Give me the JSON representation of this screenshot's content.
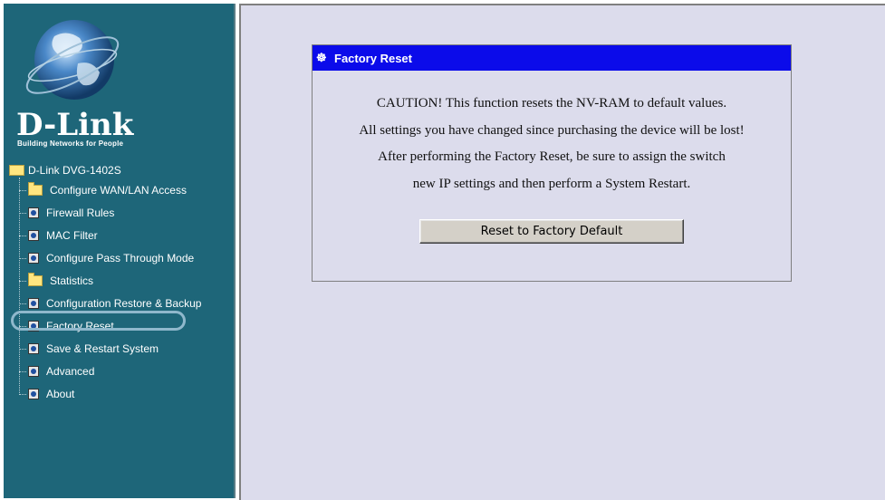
{
  "logo": {
    "brand": "D-Link",
    "tagline": "Building Networks for People"
  },
  "tree": {
    "root_label": "D-Link DVG-1402S",
    "items": [
      {
        "label": "Configure WAN/LAN Access",
        "icon": "folder-icon"
      },
      {
        "label": "Firewall Rules",
        "icon": "page-icon"
      },
      {
        "label": "MAC Filter",
        "icon": "page-icon"
      },
      {
        "label": "Configure Pass Through Mode",
        "icon": "page-icon"
      },
      {
        "label": "Statistics",
        "icon": "folder-icon"
      },
      {
        "label": "Configuration Restore & Backup",
        "icon": "page-icon"
      },
      {
        "label": "Factory Reset",
        "icon": "page-icon",
        "selected": true
      },
      {
        "label": "Save & Restart System",
        "icon": "page-icon"
      },
      {
        "label": "Advanced",
        "icon": "page-icon"
      },
      {
        "label": "About",
        "icon": "page-icon"
      }
    ]
  },
  "panel": {
    "title": "Factory Reset",
    "lines": [
      "CAUTION! This function resets the NV-RAM to default values.",
      "All settings you have changed since purchasing the device will be lost!",
      "After performing the Factory Reset, be sure to assign the switch",
      "new IP settings and then perform a System Restart."
    ],
    "button_label": "Reset to Factory Default"
  },
  "colors": {
    "sidebar_bg": "#1e6679",
    "content_bg": "#dcdcec",
    "panel_header": "#0b0bea",
    "highlight": "#8fb8cc"
  }
}
